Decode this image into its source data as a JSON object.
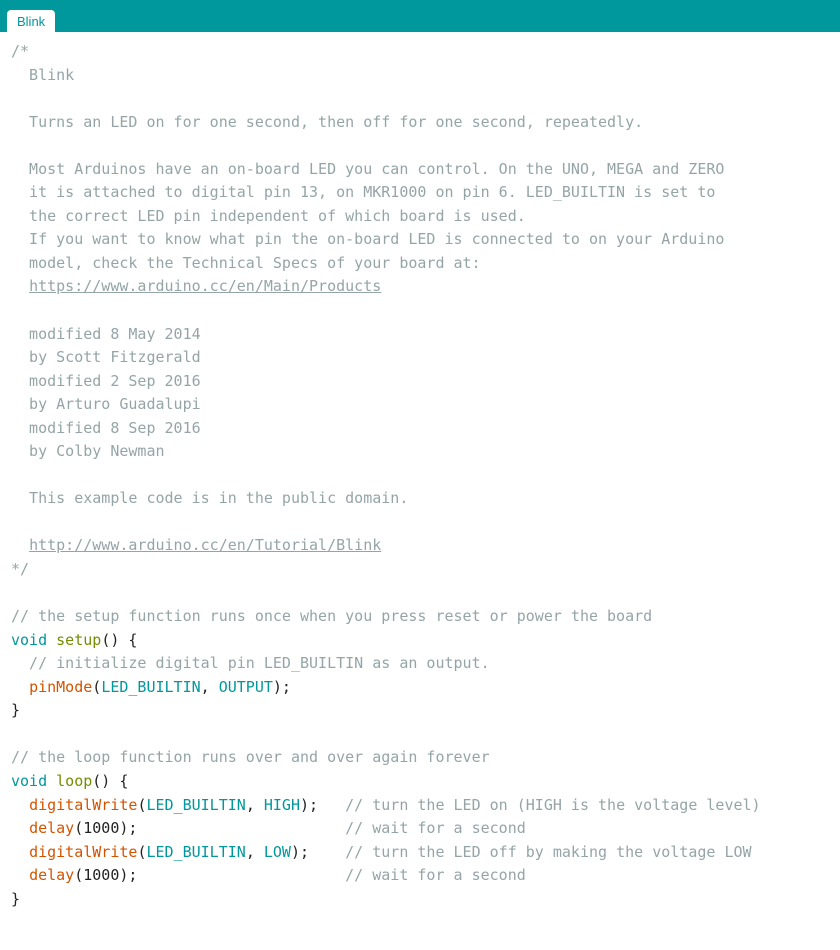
{
  "tab": {
    "label": "Blink"
  },
  "code": {
    "c01": "/*",
    "c02": "  Blink",
    "c03": "",
    "c04": "  Turns an LED on for one second, then off for one second, repeatedly.",
    "c05": "",
    "c06": "  Most Arduinos have an on-board LED you can control. On the UNO, MEGA and ZERO",
    "c07": "  it is attached to digital pin 13, on MKR1000 on pin 6. LED_BUILTIN is set to",
    "c08": "  the correct LED pin independent of which board is used.",
    "c09": "  If you want to know what pin the on-board LED is connected to on your Arduino",
    "c10": "  model, check the Technical Specs of your board at:",
    "c11p": "  ",
    "c11": "https://www.arduino.cc/en/Main/Products",
    "c12": "",
    "c13": "  modified 8 May 2014",
    "c14": "  by Scott Fitzgerald",
    "c15": "  modified 2 Sep 2016",
    "c16": "  by Arturo Guadalupi",
    "c17": "  modified 8 Sep 2016",
    "c18": "  by Colby Newman",
    "c19": "",
    "c20": "  This example code is in the public domain.",
    "c21": "",
    "c22p": "  ",
    "c22": "http://www.arduino.cc/en/Tutorial/Blink",
    "c23": "*/",
    "l24": "",
    "l25": "// the setup function runs once when you press reset or power the board",
    "l26_void": "void",
    "l26_sp1": " ",
    "l26_name": "setup",
    "l26_rest": "() {",
    "l27": "  // initialize digital pin LED_BUILTIN as an output.",
    "l28_pre": "  ",
    "l28_fn": "pinMode",
    "l28_a": "(",
    "l28_c1": "LED_BUILTIN",
    "l28_m": ", ",
    "l28_c2": "OUTPUT",
    "l28_b": ");",
    "l29": "}",
    "l30": "",
    "l31": "// the loop function runs over and over again forever",
    "l32_void": "void",
    "l32_sp1": " ",
    "l32_name": "loop",
    "l32_rest": "() {",
    "l33_pre": "  ",
    "l33_fn": "digitalWrite",
    "l33_a": "(",
    "l33_c1": "LED_BUILTIN",
    "l33_m": ", ",
    "l33_c2": "HIGH",
    "l33_b": ");   ",
    "l33_cmt": "// turn the LED on (HIGH is the voltage level)",
    "l34_pre": "  ",
    "l34_fn": "delay",
    "l34_a": "(1000);                       ",
    "l34_cmt": "// wait for a second",
    "l35_pre": "  ",
    "l35_fn": "digitalWrite",
    "l35_a": "(",
    "l35_c1": "LED_BUILTIN",
    "l35_m": ", ",
    "l35_c2": "LOW",
    "l35_b": ");    ",
    "l35_cmt": "// turn the LED off by making the voltage LOW",
    "l36_pre": "  ",
    "l36_fn": "delay",
    "l36_a": "(1000);                       ",
    "l36_cmt": "// wait for a second",
    "l37": "}"
  }
}
